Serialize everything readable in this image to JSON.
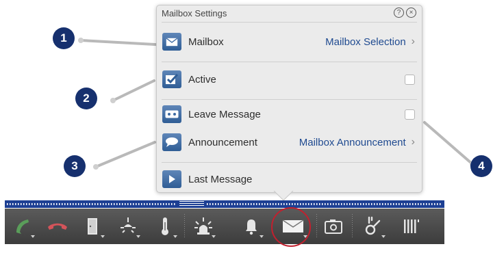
{
  "popup": {
    "title": "Mailbox Settings",
    "help_icon": "question-circle-icon",
    "close_icon": "x-circle-icon",
    "rows": [
      {
        "label": "Mailbox",
        "link": "Mailbox Selection",
        "icon": "envelope-icon"
      },
      {
        "label": "Active",
        "checked": false,
        "icon": "checkbox-icon"
      },
      {
        "label": "Leave Message",
        "checked": false,
        "icon": "cassette-icon"
      },
      {
        "label": "Announcement",
        "link": "Mailbox Announcement",
        "icon": "speech-bubble-icon"
      },
      {
        "label": "Last Message",
        "icon": "play-icon"
      }
    ]
  },
  "callouts": [
    "1",
    "2",
    "3",
    "4"
  ],
  "toolbar": {
    "items": [
      "phone-pickup-icon",
      "phone-hangup-icon",
      "door-icon",
      "light-icon",
      "thermometer-icon",
      "alarm-light-icon",
      "bell-icon",
      "mail-icon",
      "camera-icon",
      "switch-icon",
      "barcode-icon"
    ],
    "selected": "mail-icon"
  },
  "colors": {
    "callout": "#16306e",
    "link": "#1f4a90",
    "icon_blue": "#3d6aa3",
    "bar_blue": "#1d3f93",
    "highlight_ring": "#c2202e",
    "call_green": "#5a9e5a",
    "hangup_red": "#d4545a"
  }
}
